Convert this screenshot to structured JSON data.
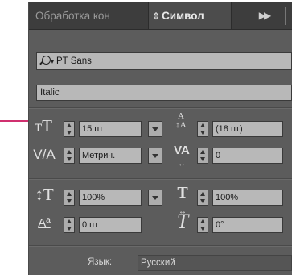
{
  "tabs": [
    {
      "label": "Обработка кон",
      "active": false
    },
    {
      "label": "Символ",
      "active": true
    }
  ],
  "panel_menu_icon": "double-chevron-right-icon",
  "font_family": {
    "value": "PT Sans",
    "icon": "search-icon"
  },
  "font_style": {
    "value": "Italic"
  },
  "controls": {
    "font_size": {
      "value": "15 пт",
      "icon": "font-size-icon"
    },
    "leading": {
      "value": "(18 пт)",
      "icon": "leading-icon"
    },
    "kerning": {
      "value": "Метрич.",
      "icon": "kerning-icon"
    },
    "tracking": {
      "value": "0",
      "icon": "tracking-icon"
    },
    "vertical_scale": {
      "value": "100%",
      "icon": "vertical-scale-icon"
    },
    "horizontal_scale": {
      "value": "100%",
      "icon": "horizontal-scale-icon"
    },
    "baseline_shift": {
      "value": "0 пт",
      "icon": "baseline-shift-icon"
    },
    "skew": {
      "value": "0°",
      "icon": "skew-icon"
    }
  },
  "language": {
    "label": "Язык:",
    "value": "Русский"
  },
  "colors": {
    "panel_bg": "#5c5c5c",
    "tabbar_bg": "#3d3d3d",
    "field_bg": "#b8b8b8",
    "callout": "#d0306f"
  }
}
